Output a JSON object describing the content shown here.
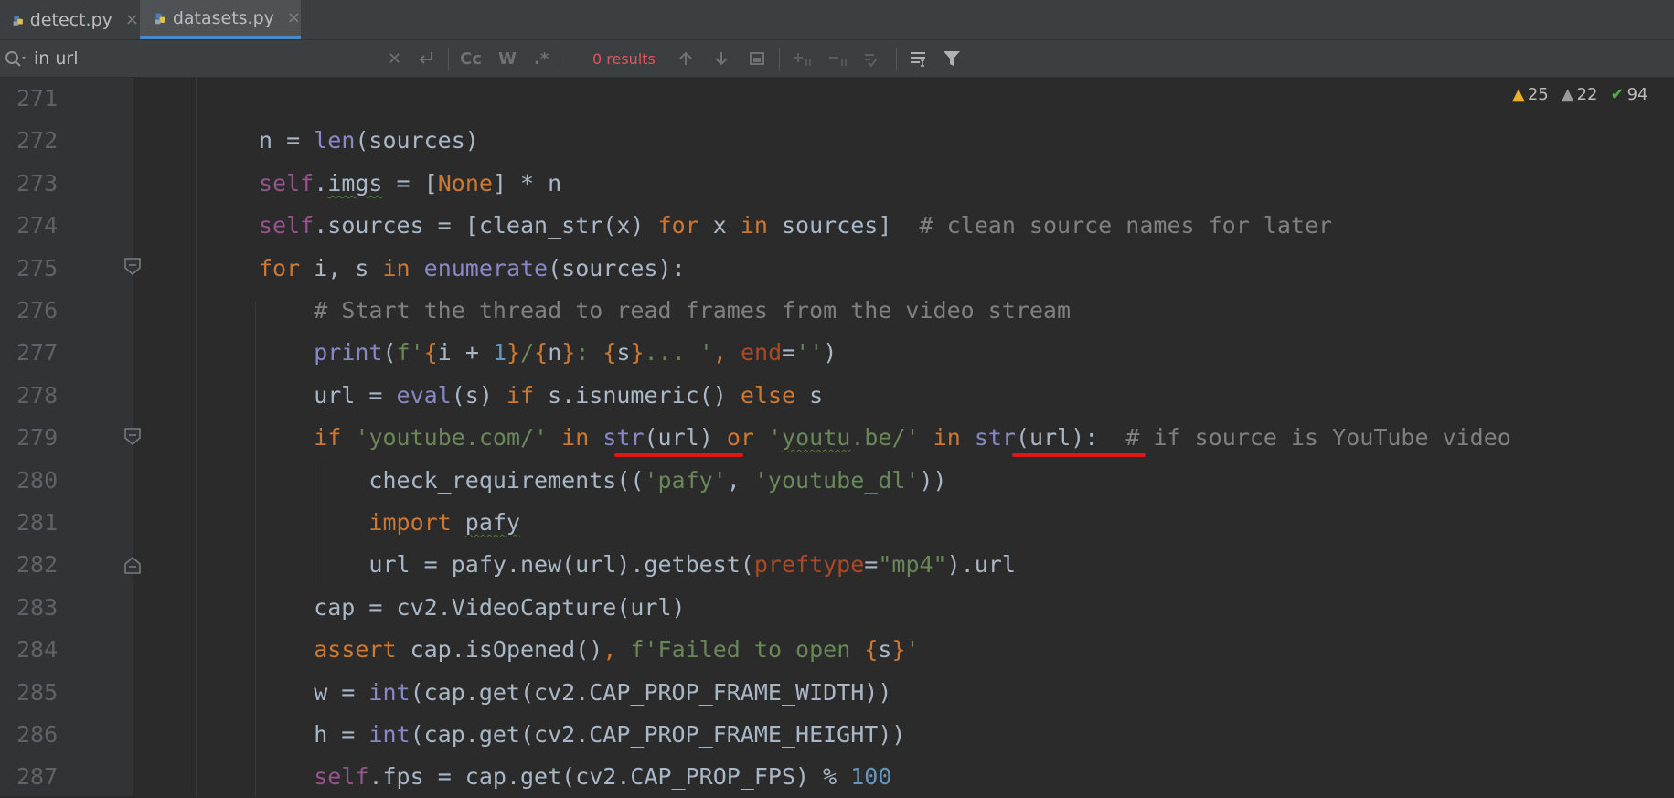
{
  "tabs": [
    {
      "label": "detect.py",
      "close": "×",
      "icon": "python-file-icon"
    },
    {
      "label": "datasets.py",
      "close": "×",
      "icon": "python-file-icon"
    }
  ],
  "search": {
    "query": "in url",
    "results": "0 results",
    "match_case": "Cc",
    "words": "W",
    "regex": ".*"
  },
  "inspections": {
    "warnings": "25",
    "weak_warnings": "22",
    "ok": "94"
  },
  "lines": [
    {
      "n": "271",
      "html": ""
    },
    {
      "n": "272",
      "html": "n = <span class='bi'>len</span>(sources)"
    },
    {
      "n": "273",
      "html": "<span class='self'>self</span>.<span class='wavy'>imgs</span> = [<span class='kw'>None</span>] * n"
    },
    {
      "n": "274",
      "html": "<span class='self'>self</span>.sources = [clean_str(x) <span class='kw'>for</span> x <span class='kw'>in</span> sources]  <span class='cmt'># clean source names for later</span>"
    },
    {
      "n": "275",
      "html": "<span class='kw'>for</span> i, s <span class='kw'>in</span> <span class='bi'>enumerate</span>(sources):"
    },
    {
      "n": "276",
      "html": "    <span class='cmt'># Start the thread to read frames from the video stream</span>"
    },
    {
      "n": "277",
      "html": "    <span class='bi'>print</span>(<span class='str'>f'</span><span class='brace'>{</span>i + <span class='num'>1</span><span class='brace'>}</span><span class='str'>/</span><span class='brace'>{</span>n<span class='brace'>}</span><span class='str'>: </span><span class='brace'>{</span>s<span class='brace'>}</span><span class='str'>... '</span><span class='kw'>,</span> <span class='param'>end</span>=<span class='str'>''</span>)"
    },
    {
      "n": "278",
      "html": "    url = <span class='bi'>eval</span>(s) <span class='kw'>if</span> s.isnumeric() <span class='kw'>else</span> s"
    },
    {
      "n": "279",
      "html": "    <span class='kw'>if</span> <span class='str'>'youtube.com/'</span> <span class='kw'>in</span> <span class='bi'>str</span>(url) <span class='kw'>or</span> <span class='str'>'<span class=\"wavy\">youtu</span>.be/'</span> <span class='kw'>in</span> <span class='bi'>str</span>(url):  <span class='cmt'># if source is YouTube video</span>"
    },
    {
      "n": "280",
      "html": "        check_requirements((<span class='str'>'pafy'</span>, <span class='str'>'youtube_dl'</span>))"
    },
    {
      "n": "281",
      "html": "        <span class='kw'>import</span> <span class='wavy'>pafy</span>"
    },
    {
      "n": "282",
      "html": "        url = pafy.new(url).getbest(<span class='param'>preftype</span>=<span class='str'>\"mp4\"</span>).url"
    },
    {
      "n": "283",
      "html": "    cap = cv2.VideoCapture(url)"
    },
    {
      "n": "284",
      "html": "    <span class='kw'>assert</span> cap.isOpened()<span class='kw'>,</span> <span class='str'>f'Failed to open </span><span class='brace'>{</span>s<span class='brace'>}</span><span class='str'>'</span>"
    },
    {
      "n": "285",
      "html": "    w = <span class='bi'>int</span>(cap.get(cv2.CAP_PROP_FRAME_WIDTH))"
    },
    {
      "n": "286",
      "html": "    h = <span class='bi'>int</span>(cap.get(cv2.CAP_PROP_FRAME_HEIGHT))"
    },
    {
      "n": "287",
      "html": "    <span class='self'>self</span>.fps = cap.get(cv2.CAP_PROP_FPS) % <span class='num'>100</span>"
    }
  ]
}
